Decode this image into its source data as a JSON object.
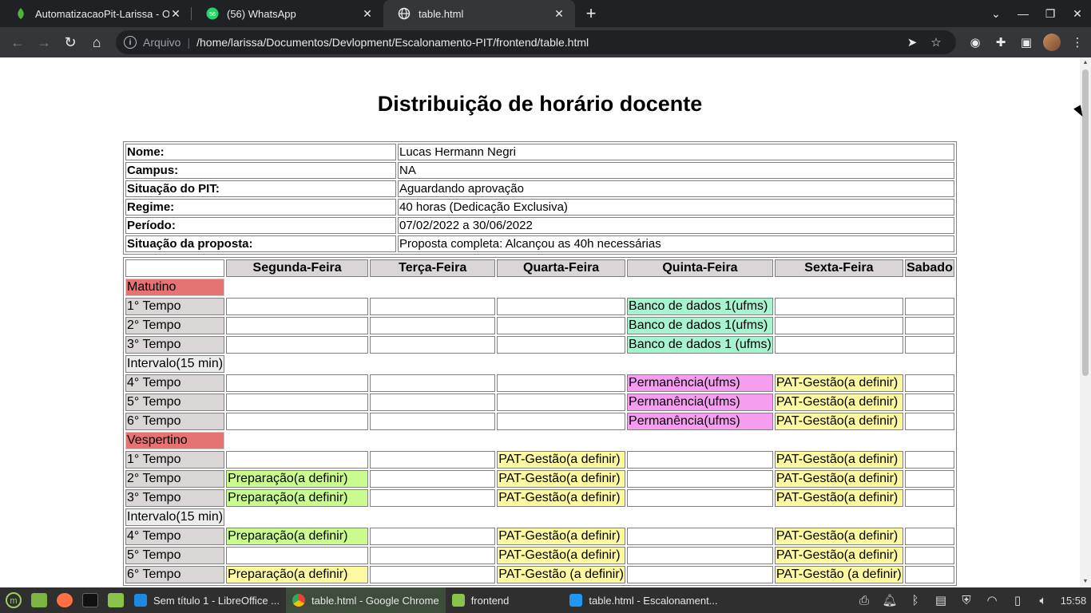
{
  "browser": {
    "tabs": [
      {
        "title": "AutomatizacaoPit-Larissa - Or",
        "icon": "leaf-icon",
        "active": false
      },
      {
        "title": "(56) WhatsApp",
        "icon": "whatsapp-icon",
        "active": false
      },
      {
        "title": "table.html",
        "icon": "globe-icon",
        "active": true
      }
    ],
    "address": {
      "scheme": "Arquivo",
      "url": "/home/larissa/Documentos/Devlopment/Escalonamento-PIT/frontend/table.html"
    }
  },
  "page": {
    "title": "Distribuição de horário docente",
    "info": [
      {
        "key": "Nome:",
        "value": "Lucas Hermann Negri"
      },
      {
        "key": "Campus:",
        "value": "NA"
      },
      {
        "key": "Situação do PIT:",
        "value": "Aguardando aprovação"
      },
      {
        "key": "Regime:",
        "value": "40 horas (Dedicação Exclusiva)"
      },
      {
        "key": "Período:",
        "value": "07/02/2022 a 30/06/2022"
      },
      {
        "key": "Situação da proposta:",
        "value": "Proposta completa: Alcançou as 40h necessárias"
      }
    ],
    "days": [
      "Segunda-Feira",
      "Terça-Feira",
      "Quarta-Feira",
      "Quinta-Feira",
      "Sexta-Feira",
      "Sabado"
    ],
    "colors": {
      "period": "#e57373",
      "db": "#a7f3d0",
      "perm": "#f59ef0",
      "pat": "#fdf9a1",
      "prep": "#c9fb8f"
    },
    "schedule": {
      "matutino": {
        "label": "Matutino",
        "rows": [
          {
            "slot": "1° Tempo",
            "cells": [
              "",
              "",
              "",
              "Banco de dados 1(ufms)",
              "",
              ""
            ]
          },
          {
            "slot": "2° Tempo",
            "cells": [
              "",
              "",
              "",
              "Banco de dados 1(ufms)",
              "",
              ""
            ]
          },
          {
            "slot": "3° Tempo",
            "cells": [
              "",
              "",
              "",
              "Banco de dados 1 (ufms)",
              "",
              ""
            ]
          },
          {
            "slot": "Intervalo(15 min)"
          },
          {
            "slot": "4° Tempo",
            "cells": [
              "",
              "",
              "",
              "Permanência(ufms)",
              "PAT-Gestão(a definir)",
              ""
            ]
          },
          {
            "slot": "5° Tempo",
            "cells": [
              "",
              "",
              "",
              "Permanência(ufms)",
              "PAT-Gestão(a definir)",
              ""
            ]
          },
          {
            "slot": "6° Tempo",
            "cells": [
              "",
              "",
              "",
              "Permanência(ufms)",
              "PAT-Gestão(a definir)",
              ""
            ]
          }
        ]
      },
      "vespertino": {
        "label": "Vespertino",
        "rows": [
          {
            "slot": "1° Tempo",
            "cells": [
              "",
              "",
              "PAT-Gestão(a definir)",
              "",
              "PAT-Gestão(a definir)",
              ""
            ]
          },
          {
            "slot": "2° Tempo",
            "cells": [
              "Preparação(a definir)",
              "",
              "PAT-Gestão(a definir)",
              "",
              "PAT-Gestão(a definir)",
              ""
            ]
          },
          {
            "slot": "3° Tempo",
            "cells": [
              "Preparação(a definir)",
              "",
              "PAT-Gestão(a definir)",
              "",
              "PAT-Gestão(a definir)",
              ""
            ]
          },
          {
            "slot": "Intervalo(15 min)"
          },
          {
            "slot": "4° Tempo",
            "cells": [
              "Preparação(a definir)",
              "",
              "PAT-Gestão(a definir)",
              "",
              "PAT-Gestão(a definir)",
              ""
            ]
          },
          {
            "slot": "5° Tempo",
            "cells": [
              "",
              "",
              "PAT-Gestão(a definir)",
              "",
              "PAT-Gestão(a definir)",
              ""
            ]
          },
          {
            "slot": "6° Tempo",
            "cells": [
              "Preparação(a definir)",
              "",
              "PAT-Gestão (a definir)",
              "",
              "PAT-Gestão (a definir)",
              ""
            ]
          }
        ]
      }
    }
  },
  "taskbar": {
    "tasks": [
      {
        "label": "Sem título 1 - LibreOffice ...",
        "icon": "writer-icon"
      },
      {
        "label": "table.html - Google Chrome",
        "icon": "chrome-icon",
        "active": true
      },
      {
        "label": "frontend",
        "icon": "folder-icon"
      },
      {
        "label": "table.html - Escalonament...",
        "icon": "vscode-icon"
      }
    ],
    "clock": "15:58"
  }
}
